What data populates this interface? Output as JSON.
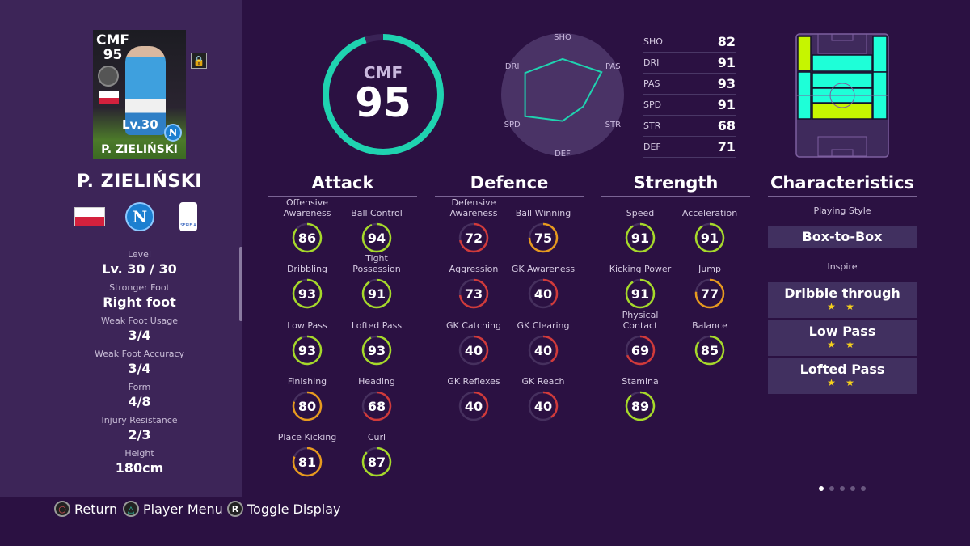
{
  "card": {
    "position": "CMF",
    "rating": "95",
    "level": "Lv.30",
    "name": "P. ZIELIŃSKI"
  },
  "player": {
    "name": "P. ZIELIŃSKI",
    "club": "N",
    "league": "SERIE A"
  },
  "info": [
    {
      "label": "Level",
      "value": "Lv. 30 / 30"
    },
    {
      "label": "Stronger Foot",
      "value": "Right foot"
    },
    {
      "label": "Weak Foot Usage",
      "value": "3/4"
    },
    {
      "label": "Weak Foot Accuracy",
      "value": "3/4"
    },
    {
      "label": "Form",
      "value": "4/8"
    },
    {
      "label": "Injury Resistance",
      "value": "2/3"
    },
    {
      "label": "Height",
      "value": "180cm"
    }
  ],
  "overall": {
    "position": "CMF",
    "rating": "95",
    "fill_percent": 95
  },
  "radar": {
    "axes": [
      "SHO",
      "PAS",
      "STR",
      "DEF",
      "SPD",
      "DRI"
    ],
    "values": [
      82,
      93,
      68,
      71,
      91,
      91
    ]
  },
  "radar_table": [
    {
      "k": "SHO",
      "v": "82"
    },
    {
      "k": "DRI",
      "v": "91"
    },
    {
      "k": "PAS",
      "v": "93"
    },
    {
      "k": "SPD",
      "v": "91"
    },
    {
      "k": "STR",
      "v": "68"
    },
    {
      "k": "DEF",
      "v": "71"
    }
  ],
  "sections": {
    "attack": "Attack",
    "defence": "Defence",
    "strength": "Strength",
    "characteristics": "Characteristics"
  },
  "attack": [
    [
      "Offensive Awareness",
      86
    ],
    [
      "Ball Control",
      94
    ],
    [
      "Dribbling",
      93
    ],
    [
      "Tight Possession",
      91
    ],
    [
      "Low Pass",
      93
    ],
    [
      "Lofted Pass",
      93
    ],
    [
      "Finishing",
      80
    ],
    [
      "Heading",
      68
    ],
    [
      "Place Kicking",
      81
    ],
    [
      "Curl",
      87
    ]
  ],
  "defence": [
    [
      "Defensive Awareness",
      72
    ],
    [
      "Ball Winning",
      75
    ],
    [
      "Aggression",
      73
    ],
    [
      "GK Awareness",
      40
    ],
    [
      "GK Catching",
      40
    ],
    [
      "GK Clearing",
      40
    ],
    [
      "GK Reflexes",
      40
    ],
    [
      "GK Reach",
      40
    ]
  ],
  "strength": [
    [
      "Speed",
      91
    ],
    [
      "Acceleration",
      91
    ],
    [
      "Kicking Power",
      91
    ],
    [
      "Jump",
      77
    ],
    [
      "Physical Contact",
      69
    ],
    [
      "Balance",
      85
    ],
    [
      "Stamina",
      89
    ]
  ],
  "characteristics": {
    "playing_style_label": "Playing Style",
    "playing_style": "Box-to-Box",
    "inspire_label": "Inspire",
    "inspire": [
      {
        "name": "Dribble through",
        "stars": "★ ★"
      },
      {
        "name": "Low Pass",
        "stars": "★ ★"
      },
      {
        "name": "Lofted Pass",
        "stars": "★ ★"
      }
    ]
  },
  "footer": [
    {
      "icon": "circle-button-icon",
      "label": "Return"
    },
    {
      "icon": "triangle-button-icon",
      "label": "Player Menu"
    },
    {
      "icon": "r-button-icon",
      "label": "Toggle Display"
    }
  ],
  "colors": {
    "high": "#a6d92a",
    "mid": "#e79a1e",
    "low": "#d13a3a",
    "accent": "#1fd3b0",
    "pitch_primary": "#1effd8",
    "pitch_secondary": "#c6f500"
  },
  "pagination": {
    "pages": 5,
    "current": 1
  }
}
